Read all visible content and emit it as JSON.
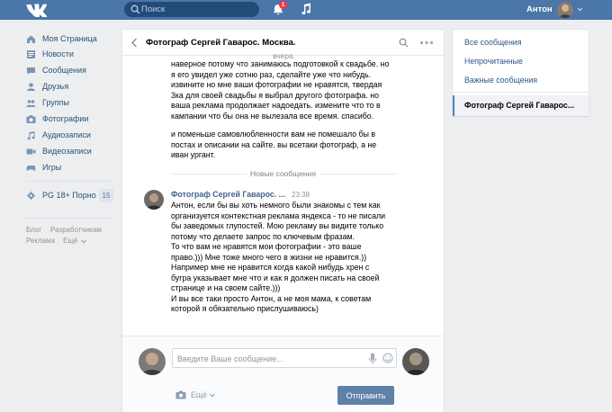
{
  "topbar": {
    "search_placeholder": "Поиск",
    "notifications_count": "1",
    "user_name": "Антон"
  },
  "menu": {
    "items": [
      {
        "label": "Моя Страница",
        "icon": "home-icon"
      },
      {
        "label": "Новости",
        "icon": "news-icon"
      },
      {
        "label": "Сообщения",
        "icon": "messages-icon"
      },
      {
        "label": "Друзья",
        "icon": "friends-icon"
      },
      {
        "label": "Группы",
        "icon": "groups-icon"
      },
      {
        "label": "Фотографии",
        "icon": "photo-icon"
      },
      {
        "label": "Аудиозаписи",
        "icon": "audio-icon"
      },
      {
        "label": "Видеозаписи",
        "icon": "video-icon"
      },
      {
        "label": "Игры",
        "icon": "games-icon"
      }
    ],
    "community": {
      "label": "PG 18+ Порно",
      "badge": "15"
    },
    "footer": {
      "blog": "Блог",
      "developers": "Разработчикам",
      "ads": "Реклама",
      "more": "Ещё"
    }
  },
  "dialog": {
    "title": "Фотограф Сергей Гаварос. Москва.",
    "day_label": "вчера",
    "earlier_message_1": "наверное потому что занимаюсь подготовкой к свадьбе. но\nя его увидел уже сотню раз, сделайте уже что нибудь.\nизвините но мне ваши фотографии не нравятся, твердая\n3ка для своей свадьбы я выбрал другого фотографа. но\nваша реклама продолжает надоедать. измените что то в\nкампании что бы она не вылезала все время. спасибо.",
    "earlier_message_2": "и поменьше самовлюбленности вам не помешало бы в\nпостах и описании на сайте. вы всетаки фотограф, а не\nиван ургант.",
    "new_messages_label": "Новые сообщения",
    "incoming": {
      "author": "Фотограф Сергей Гаварос. ...",
      "time": "23:38",
      "text": "Антон, если бы вы хоть немного были знакомы с тем как\nорганизуется контекстная реклама яндекса - то не писали\nбы заведомых глупостей. Мою рекламу вы видите только\nпотому что делаете запрос по ключевым фразам.\nТо что вам не нравятся мои фотографии - это ваше\nправо.))) Мне тоже много чего в жизни не нравится.))\nНапример мне не нравится когда какой нибудь хрен с\nбугра указывает мне что и как я должен писать на своей\nстранице и на своем сайте.)))\nИ вы все таки просто Антон, а не моя мама, к советам\nкоторой я обязательно прислушиваюсь)"
    },
    "composer": {
      "placeholder": "Введите Ваше сообщение...",
      "more_label": "Ещё",
      "send_label": "Отправить"
    }
  },
  "right_panel": {
    "items": [
      "Все сообщения",
      "Непрочитанные",
      "Важные сообщения"
    ],
    "active_dialog": "Фотограф Сергей Гаварос..."
  },
  "colors": {
    "header": "#4a76a8",
    "link": "#2a5885",
    "send_button": "#5e81a8",
    "badge_red": "#ff3347"
  }
}
